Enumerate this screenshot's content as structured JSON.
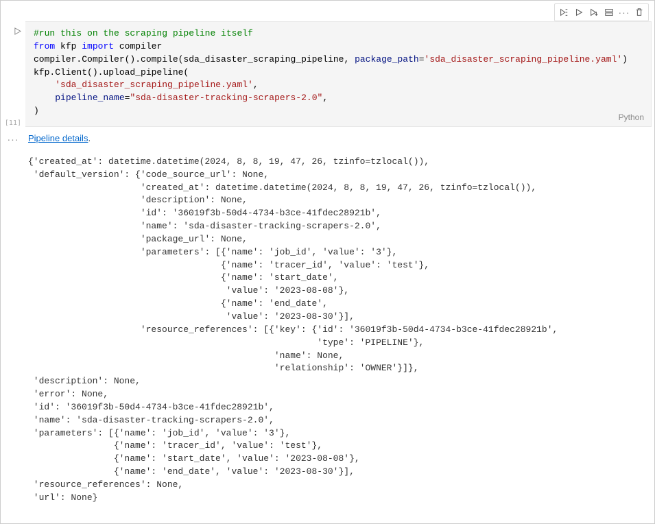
{
  "toolbar": {
    "lang_label": "Python",
    "exec_count": "[11]"
  },
  "code": {
    "l1_comment": "#run this on the scraping pipeline itself",
    "l2_from": "from",
    "l2_mod": " kfp ",
    "l2_import": "import",
    "l2_target": " compiler",
    "l3_a": "compiler.Compiler().compile(sda_disaster_scraping_pipeline, ",
    "l3_arg": "package_path",
    "l3_eq": "=",
    "l3_str": "'sda_disaster_scraping_pipeline.yaml'",
    "l3_b": ")",
    "l4": "kfp.Client().upload_pipeline(",
    "l5_indent": "    ",
    "l5_str": "'sda_disaster_scraping_pipeline.yaml'",
    "l5_end": ",",
    "l6_indent": "    ",
    "l6_arg": "pipeline_name",
    "l6_eq": "=",
    "l6_str": "\"sda-disaster-tracking-scrapers-2.0\"",
    "l6_end": ",",
    "l7": ")"
  },
  "output": {
    "link_text": "Pipeline details",
    "dot": ".",
    "gutter": "···",
    "pre": "{'created_at': datetime.datetime(2024, 8, 8, 19, 47, 26, tzinfo=tzlocal()),\n 'default_version': {'code_source_url': None,\n                     'created_at': datetime.datetime(2024, 8, 8, 19, 47, 26, tzinfo=tzlocal()),\n                     'description': None,\n                     'id': '36019f3b-50d4-4734-b3ce-41fdec28921b',\n                     'name': 'sda-disaster-tracking-scrapers-2.0',\n                     'package_url': None,\n                     'parameters': [{'name': 'job_id', 'value': '3'},\n                                    {'name': 'tracer_id', 'value': 'test'},\n                                    {'name': 'start_date',\n                                     'value': '2023-08-08'},\n                                    {'name': 'end_date',\n                                     'value': '2023-08-30'}],\n                     'resource_references': [{'key': {'id': '36019f3b-50d4-4734-b3ce-41fdec28921b',\n                                                      'type': 'PIPELINE'},\n                                              'name': None,\n                                              'relationship': 'OWNER'}]},\n 'description': None,\n 'error': None,\n 'id': '36019f3b-50d4-4734-b3ce-41fdec28921b',\n 'name': 'sda-disaster-tracking-scrapers-2.0',\n 'parameters': [{'name': 'job_id', 'value': '3'},\n                {'name': 'tracer_id', 'value': 'test'},\n                {'name': 'start_date', 'value': '2023-08-08'},\n                {'name': 'end_date', 'value': '2023-08-30'}],\n 'resource_references': None,\n 'url': None}"
  }
}
